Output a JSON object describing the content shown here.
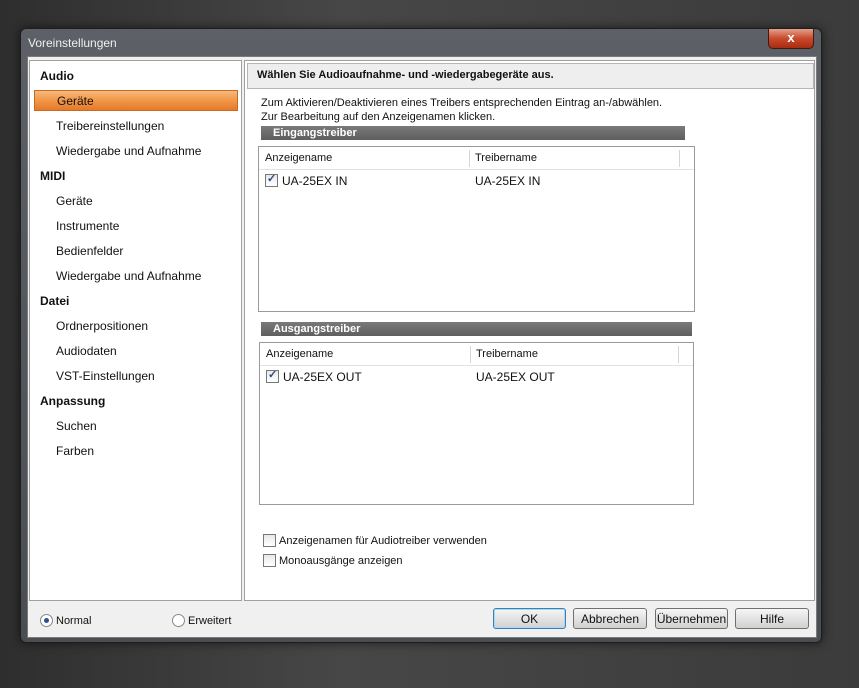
{
  "window": {
    "title": "Voreinstellungen",
    "close_glyph": "x"
  },
  "nav": {
    "groups": [
      {
        "label": "Audio",
        "items": [
          "Geräte",
          "Treibereinstellungen",
          "Wiedergabe und Aufnahme"
        ]
      },
      {
        "label": "MIDI",
        "items": [
          "Geräte",
          "Instrumente",
          "Bedienfelder",
          "Wiedergabe und Aufnahme"
        ]
      },
      {
        "label": "Datei",
        "items": [
          "Ordnerpositionen",
          "Audiodaten",
          "VST-Einstellungen"
        ]
      },
      {
        "label": "Anpassung",
        "items": [
          "Suchen",
          "Farben"
        ]
      }
    ],
    "selected": "Audio / Geräte"
  },
  "panel": {
    "header": "Wählen Sie Audioaufnahme- und -wiedergabegeräte aus.",
    "info_line1": "Zum Aktivieren/Deaktivieren eines Treibers entsprechenden Eintrag an-/abwählen.",
    "info_line2": "Zur Bearbeitung auf den Anzeigenamen klicken.",
    "input": {
      "title": "Eingangstreiber",
      "col1": "Anzeigename",
      "col2": "Treibername",
      "rows": [
        {
          "checked": true,
          "display_name": "UA-25EX IN",
          "driver_name": "UA-25EX IN"
        }
      ]
    },
    "output": {
      "title": "Ausgangstreiber",
      "col1": "Anzeigename",
      "col2": "Treibername",
      "rows": [
        {
          "checked": true,
          "display_name": "UA-25EX OUT",
          "driver_name": "UA-25EX OUT"
        }
      ]
    },
    "option1": {
      "label": "Anzeigenamen für Audiotreiber verwenden",
      "checked": false
    },
    "option2": {
      "label": "Monoausgänge anzeigen",
      "checked": false
    }
  },
  "footer": {
    "mode_normal": "Normal",
    "mode_extended": "Erweitert",
    "selected_mode": "Normal",
    "ok": "OK",
    "cancel": "Abbrechen",
    "apply": "Übernehmen",
    "help": "Hilfe"
  }
}
